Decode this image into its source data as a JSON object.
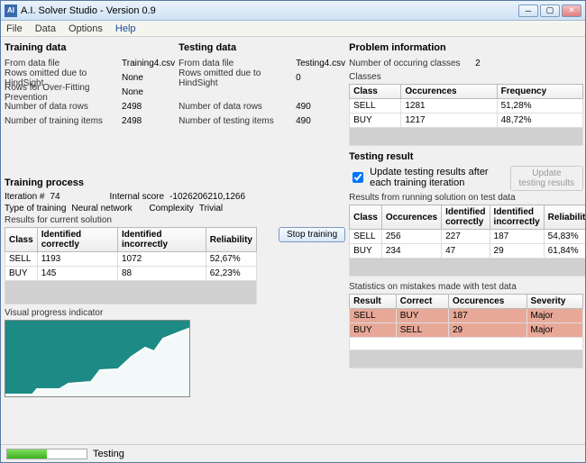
{
  "window": {
    "title": "A.I. Solver Studio - Version 0.9"
  },
  "menu": {
    "file": "File",
    "data": "Data",
    "options": "Options",
    "help": "Help"
  },
  "training_data": {
    "heading": "Training data",
    "from_file_lbl": "From data file",
    "from_file": "Training4.csv",
    "rows_hind_lbl": "Rows omitted due to HindSight",
    "rows_hind": "None",
    "rows_ofp_lbl": "Rows for Over-Fitting Prevention",
    "rows_ofp": "None",
    "num_rows_lbl": "Number of data rows",
    "num_rows": "2498",
    "num_items_lbl": "Number of training items",
    "num_items": "2498"
  },
  "testing_data": {
    "heading": "Testing data",
    "from_file_lbl": "From data file",
    "from_file": "Testing4.csv",
    "rows_hind_lbl": "Rows omitted due to HindSight",
    "rows_hind": "0",
    "num_rows_lbl": "Number of data rows",
    "num_rows": "490",
    "num_items_lbl": "Number of testing items",
    "num_items": "490"
  },
  "problem": {
    "heading": "Problem information",
    "num_classes_lbl": "Number of occuring classes",
    "num_classes": "2",
    "classes_lbl": "Classes",
    "cols": {
      "class": "Class",
      "occ": "Occurences",
      "freq": "Frequency"
    },
    "rows": [
      {
        "class": "SELL",
        "occ": "1281",
        "freq": "51,28%"
      },
      {
        "class": "BUY",
        "occ": "1217",
        "freq": "48,72%"
      }
    ]
  },
  "process": {
    "heading": "Training process",
    "iter_lbl": "Iteration #",
    "iter": "74",
    "score_lbl": "Internal score",
    "score": "-1026206210,1266",
    "type_lbl": "Type of training",
    "type": "Neural network",
    "complexity_lbl": "Complexity",
    "complexity": "Trivial",
    "results_lbl": "Results for current solution",
    "stop_btn": "Stop training",
    "cols": {
      "class": "Class",
      "idc": "Identified correctly",
      "idi": "Identified incorrectly",
      "rel": "Reliability"
    },
    "rows": [
      {
        "class": "SELL",
        "idc": "1193",
        "idi": "1072",
        "rel": "52,67%"
      },
      {
        "class": "BUY",
        "idc": "145",
        "idi": "88",
        "rel": "62,23%"
      }
    ],
    "vpi_lbl": "Visual progress indicator"
  },
  "testing_result": {
    "heading": "Testing result",
    "update_chk": "Update testing results after each training iteration",
    "update_btn": "Update testing results",
    "results_lbl": "Results from running solution on test data",
    "cols": {
      "class": "Class",
      "occ": "Occurences",
      "idc": "Identified correctly",
      "idi": "Identified incorrectly",
      "rel": "Reliability"
    },
    "rows": [
      {
        "class": "SELL",
        "occ": "256",
        "idc": "227",
        "idi": "187",
        "rel": "54,83%"
      },
      {
        "class": "BUY",
        "occ": "234",
        "idc": "47",
        "idi": "29",
        "rel": "61,84%"
      }
    ],
    "stats_lbl": "Statistics on mistakes made with test data",
    "scols": {
      "result": "Result",
      "correct": "Correct",
      "occ": "Occurences",
      "sev": "Severity"
    },
    "srows": [
      {
        "result": "SELL",
        "correct": "BUY",
        "occ": "187",
        "sev": "Major"
      },
      {
        "result": "BUY",
        "correct": "SELL",
        "occ": "29",
        "sev": "Major"
      }
    ]
  },
  "status": {
    "text": "Testing"
  }
}
